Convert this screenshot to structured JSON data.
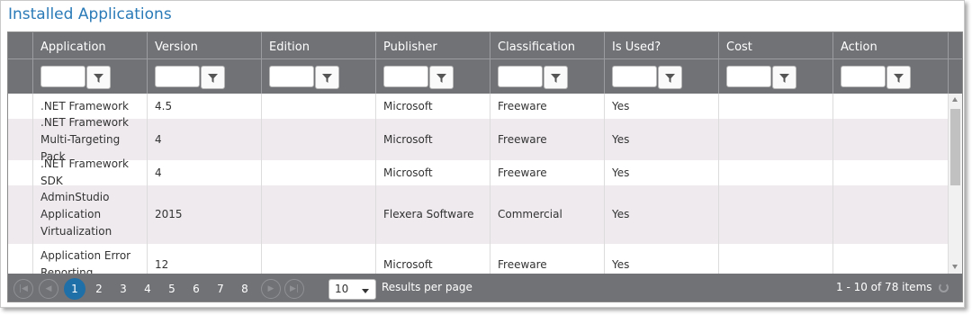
{
  "panel": {
    "title": "Installed Applications"
  },
  "columns": [
    "Application",
    "Version",
    "Edition",
    "Publisher",
    "Classification",
    "Is Used?",
    "Cost",
    "Action"
  ],
  "rows": [
    {
      "application": ".NET Framework",
      "version": "4.5",
      "edition": "",
      "publisher": "Microsoft",
      "classification": "Freeware",
      "is_used": "Yes",
      "cost": "",
      "action": ""
    },
    {
      "application": ".NET Framework Multi-Targeting Pack",
      "version": "4",
      "edition": "",
      "publisher": "Microsoft",
      "classification": "Freeware",
      "is_used": "Yes",
      "cost": "",
      "action": ""
    },
    {
      "application": ".NET Framework SDK",
      "version": "4",
      "edition": "",
      "publisher": "Microsoft",
      "classification": "Freeware",
      "is_used": "Yes",
      "cost": "",
      "action": ""
    },
    {
      "application": "AdminStudio Application Virtualization",
      "version": "2015",
      "edition": "",
      "publisher": "Flexera Software",
      "classification": "Commercial",
      "is_used": "Yes",
      "cost": "",
      "action": ""
    },
    {
      "application": "Application Error Reporting",
      "version": "12",
      "edition": "",
      "publisher": "Microsoft",
      "classification": "Freeware",
      "is_used": "Yes",
      "cost": "",
      "action": ""
    }
  ],
  "pager": {
    "pages": [
      "1",
      "2",
      "3",
      "4",
      "5",
      "6",
      "7",
      "8"
    ],
    "current_page": "1",
    "page_size": "10",
    "results_per_page_label": "Results per page",
    "info": "1 - 10 of 78 items"
  },
  "icons": {
    "filter": "filter-icon",
    "first": "first-page-icon",
    "prev": "prev-page-icon",
    "next": "next-page-icon",
    "last": "last-page-icon",
    "refresh": "refresh-icon"
  },
  "colors": {
    "title": "#2a7ab8",
    "header_bg": "#707276",
    "alt_row": "#eeeaee",
    "current_page": "#1f6fa8"
  }
}
